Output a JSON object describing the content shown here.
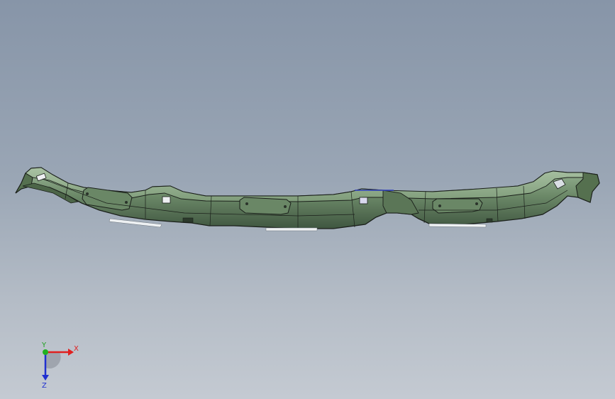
{
  "viewport": {
    "background_top": "#8795a8",
    "background_bottom": "#c4cad2"
  },
  "model": {
    "name": "bumper-lip-part",
    "fill_color": "#5f7a5c",
    "highlight_color": "#8aa585",
    "edge_color": "#1a1f1a"
  },
  "triad": {
    "x_label": "X",
    "y_label": "Y",
    "z_label": "Z",
    "x_color": "#e02020",
    "y_color": "#20b020",
    "z_color": "#2030d0"
  }
}
